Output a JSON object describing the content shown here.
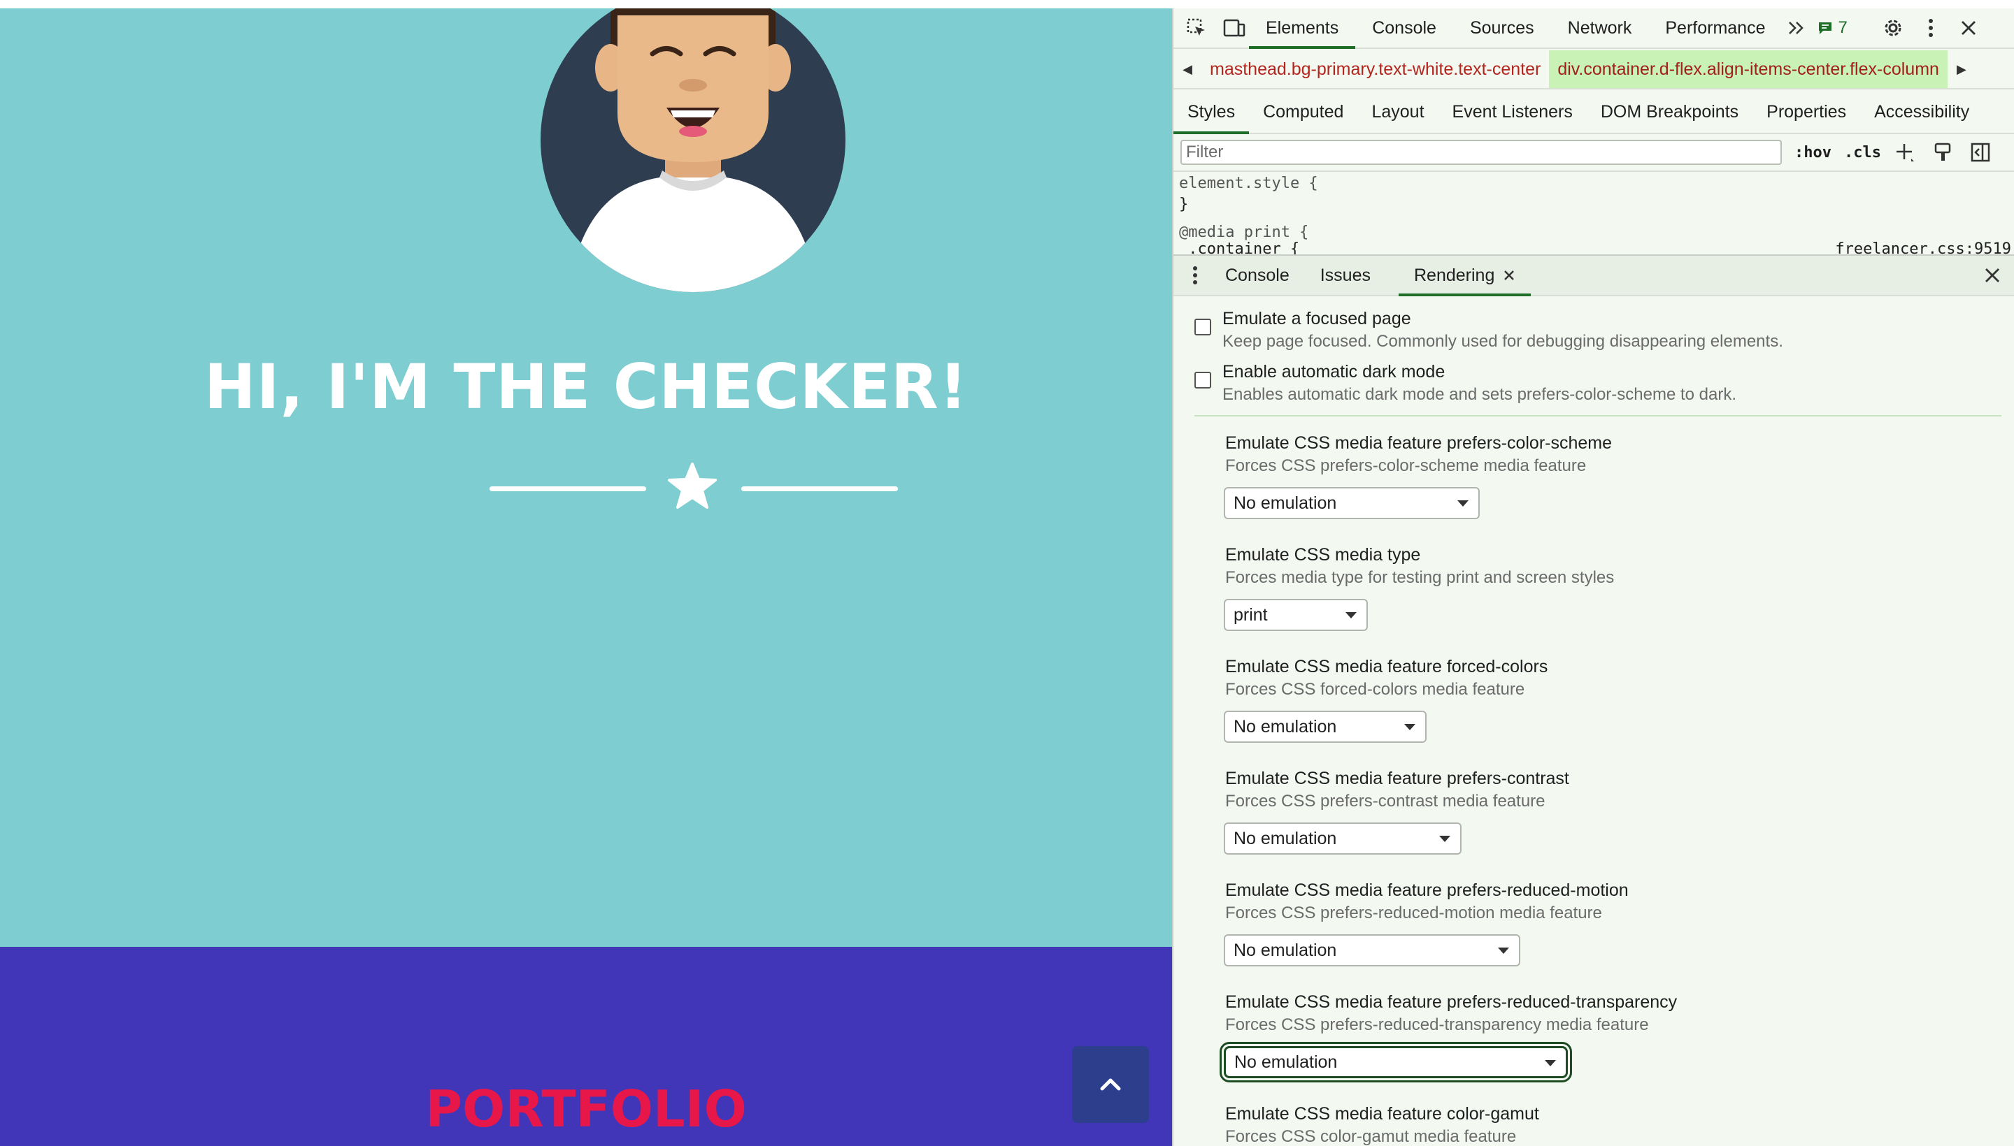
{
  "page": {
    "hero_title": "HI, I'M THE CHECKER!",
    "portfolio_title": "PORTFOLIO",
    "colors": {
      "masthead": "#7ecdd1",
      "portfolio_bg": "#4135b8",
      "portfolio_title": "#e8174a",
      "scroll_top_bg": "#2c3e8c"
    }
  },
  "devtools": {
    "tabs": [
      "Elements",
      "Console",
      "Sources",
      "Network",
      "Performance"
    ],
    "active_tab": "Elements",
    "issues_count": "7",
    "breadcrumb": [
      "masthead.bg-primary.text-white.text-center",
      "div.container.d-flex.align-items-center.flex-column"
    ],
    "subtabs": [
      "Styles",
      "Computed",
      "Layout",
      "Event Listeners",
      "DOM Breakpoints",
      "Properties",
      "Accessibility"
    ],
    "filter_placeholder": "Filter",
    "hov_label": ":hov",
    "cls_label": ".cls",
    "styles": {
      "line1": "element.style {",
      "line2": "}",
      "line3": "@media print {",
      "line4": " .container {",
      "source": "freelancer.css:9519"
    },
    "drawer_tabs": [
      "Console",
      "Issues",
      "Rendering"
    ],
    "rendering": {
      "checkboxes": [
        {
          "title": "Emulate a focused page",
          "desc": "Keep page focused. Commonly used for debugging disappearing elements.",
          "checked": false
        },
        {
          "title": "Enable automatic dark mode",
          "desc": "Enables automatic dark mode and sets prefers-color-scheme to dark.",
          "checked": false
        }
      ],
      "emulations": [
        {
          "title": "Emulate CSS media feature prefers-color-scheme",
          "desc": "Forces CSS prefers-color-scheme media feature",
          "value": "No emulation"
        },
        {
          "title": "Emulate CSS media type",
          "desc": "Forces media type for testing print and screen styles",
          "value": "print"
        },
        {
          "title": "Emulate CSS media feature forced-colors",
          "desc": "Forces CSS forced-colors media feature",
          "value": "No emulation"
        },
        {
          "title": "Emulate CSS media feature prefers-contrast",
          "desc": "Forces CSS prefers-contrast media feature",
          "value": "No emulation"
        },
        {
          "title": "Emulate CSS media feature prefers-reduced-motion",
          "desc": "Forces CSS prefers-reduced-motion media feature",
          "value": "No emulation"
        },
        {
          "title": "Emulate CSS media feature prefers-reduced-transparency",
          "desc": "Forces CSS prefers-reduced-transparency media feature",
          "value": "No emulation"
        },
        {
          "title": "Emulate CSS media feature color-gamut",
          "desc": "Forces CSS color-gamut media feature"
        }
      ]
    }
  }
}
